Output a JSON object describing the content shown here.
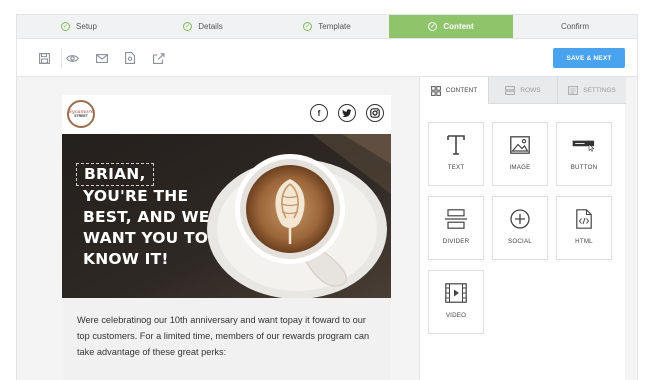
{
  "stepper": {
    "steps": [
      {
        "label": "Setup"
      },
      {
        "label": "Details"
      },
      {
        "label": "Template"
      },
      {
        "label": "Content"
      },
      {
        "label": "Confirm"
      }
    ],
    "active": "Content"
  },
  "toolbar": {
    "icons": [
      "save-icon",
      "preview-eye-icon",
      "email-icon",
      "document-icon",
      "share-export-icon"
    ],
    "save_next_label": "SAVE & NEXT"
  },
  "email": {
    "logo": {
      "line1": "Sycamore",
      "line2": "STREET"
    },
    "social": [
      "facebook-icon",
      "twitter-icon",
      "instagram-icon"
    ],
    "hero": {
      "name": "BRIAN,",
      "rest": "YOU'RE THE BEST, AND WE WANT YOU TO KNOW IT!"
    },
    "body": "Were celebratinog our 10th anniversary and want topay it foward to our top customers. For a limited time, members of our rewards program can take advantage of these great perks:"
  },
  "panel": {
    "tabs": [
      {
        "label": "CONTENT",
        "icon": "grid-icon"
      },
      {
        "label": "ROWS",
        "icon": "rows-icon"
      },
      {
        "label": "SETTINGS",
        "icon": "settings-icon"
      }
    ],
    "blocks": [
      {
        "label": "TEXT",
        "icon": "text-icon"
      },
      {
        "label": "IMAGE",
        "icon": "image-icon"
      },
      {
        "label": "BUTTON",
        "icon": "button-icon"
      },
      {
        "label": "DIVIDER",
        "icon": "divider-icon"
      },
      {
        "label": "SOCIAL",
        "icon": "social-icon"
      },
      {
        "label": "HTML",
        "icon": "html-icon"
      },
      {
        "label": "VIDEO",
        "icon": "video-icon"
      }
    ]
  },
  "colors": {
    "accent_green": "#8fc46a",
    "button_blue": "#4aa3ee",
    "hero_dark": "#2c2724"
  }
}
